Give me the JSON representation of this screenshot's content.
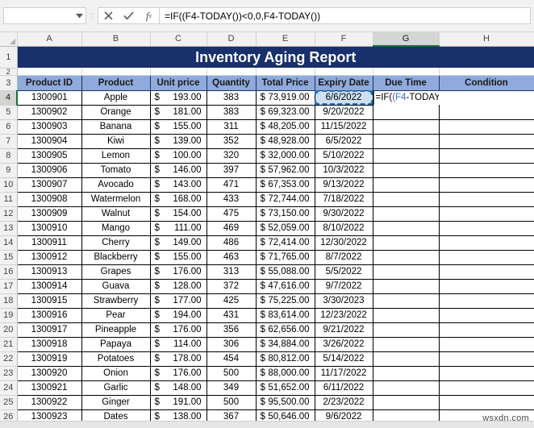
{
  "formula_bar": {
    "name_box_value": "",
    "name_box_placeholder": "",
    "cancel_icon": "cancel-x-icon",
    "confirm_icon": "confirm-check-icon",
    "insert_function_icon": "fx-icon",
    "formula_text": "=IF((F4-TODAY())<0,0,F4-TODAY())"
  },
  "sheet": {
    "column_headers": [
      "A",
      "B",
      "C",
      "D",
      "E",
      "F",
      "G",
      "H"
    ],
    "active_column": "G",
    "active_row": 4,
    "row_numbers": [
      1,
      2,
      3,
      4,
      5,
      6,
      7,
      8,
      9,
      10,
      11,
      12,
      13,
      14,
      15,
      16,
      17,
      18,
      19,
      20,
      21,
      22,
      23,
      24,
      25,
      26
    ],
    "title": "Inventory Aging Report",
    "title_bg_color": "#18306B",
    "title_text_color": "#FFFFFF",
    "header_bg_color": "#8FAADC",
    "headers": [
      "Product ID",
      "Product",
      "Unit price",
      "Quantity",
      "Total Price",
      "Expiry Date",
      "Due Time",
      "Condition"
    ],
    "source_cell": {
      "address": "F4",
      "value": "6/6/2022",
      "highlight_color": "#CFE0F3",
      "marquee_color": "#2A6FC4"
    },
    "editing_cell": {
      "address": "G4",
      "text": "=IF((F4-TODAY())<0,0,F4-TODAY())",
      "tokens": [
        {
          "t": "=IF(",
          "c": "plain"
        },
        {
          "t": "(",
          "c": "p1"
        },
        {
          "t": "F4",
          "c": "ref"
        },
        {
          "t": "-TODAY(",
          "c": "plain"
        },
        {
          "t": ")",
          "c": "p2"
        },
        {
          "t": ")",
          "c": "p1"
        },
        {
          "t": "<0,0,",
          "c": "plain"
        },
        {
          "t": "F4",
          "c": "ref"
        },
        {
          "t": "-TODAY(",
          "c": "plain"
        },
        {
          "t": ")",
          "c": "p2"
        },
        {
          "t": ")",
          "c": "p1"
        }
      ]
    },
    "rows": [
      {
        "row": 4,
        "id": "1300901",
        "product": "Apple",
        "unit_price": "193.00",
        "quantity": "383",
        "total_price": "73,919.00",
        "expiry": "6/6/2022",
        "due_time": "",
        "condition": ""
      },
      {
        "row": 5,
        "id": "1300902",
        "product": "Orange",
        "unit_price": "181.00",
        "quantity": "383",
        "total_price": "69,323.00",
        "expiry": "9/20/2022",
        "due_time": "",
        "condition": ""
      },
      {
        "row": 6,
        "id": "1300903",
        "product": "Banana",
        "unit_price": "155.00",
        "quantity": "311",
        "total_price": "48,205.00",
        "expiry": "11/15/2022",
        "due_time": "",
        "condition": ""
      },
      {
        "row": 7,
        "id": "1300904",
        "product": "Kiwi",
        "unit_price": "139.00",
        "quantity": "352",
        "total_price": "48,928.00",
        "expiry": "6/5/2022",
        "due_time": "",
        "condition": ""
      },
      {
        "row": 8,
        "id": "1300905",
        "product": "Lemon",
        "unit_price": "100.00",
        "quantity": "320",
        "total_price": "32,000.00",
        "expiry": "5/10/2022",
        "due_time": "",
        "condition": ""
      },
      {
        "row": 9,
        "id": "1300906",
        "product": "Tomato",
        "unit_price": "146.00",
        "quantity": "397",
        "total_price": "57,962.00",
        "expiry": "10/3/2022",
        "due_time": "",
        "condition": ""
      },
      {
        "row": 10,
        "id": "1300907",
        "product": "Avocado",
        "unit_price": "143.00",
        "quantity": "471",
        "total_price": "67,353.00",
        "expiry": "9/13/2022",
        "due_time": "",
        "condition": ""
      },
      {
        "row": 11,
        "id": "1300908",
        "product": "Watermelon",
        "unit_price": "168.00",
        "quantity": "433",
        "total_price": "72,744.00",
        "expiry": "7/18/2022",
        "due_time": "",
        "condition": ""
      },
      {
        "row": 12,
        "id": "1300909",
        "product": "Walnut",
        "unit_price": "154.00",
        "quantity": "475",
        "total_price": "73,150.00",
        "expiry": "9/30/2022",
        "due_time": "",
        "condition": ""
      },
      {
        "row": 13,
        "id": "1300910",
        "product": "Mango",
        "unit_price": "111.00",
        "quantity": "469",
        "total_price": "52,059.00",
        "expiry": "8/10/2022",
        "due_time": "",
        "condition": ""
      },
      {
        "row": 14,
        "id": "1300911",
        "product": "Cherry",
        "unit_price": "149.00",
        "quantity": "486",
        "total_price": "72,414.00",
        "expiry": "12/30/2022",
        "due_time": "",
        "condition": ""
      },
      {
        "row": 15,
        "id": "1300912",
        "product": "Blackberry",
        "unit_price": "155.00",
        "quantity": "463",
        "total_price": "71,765.00",
        "expiry": "8/7/2022",
        "due_time": "",
        "condition": ""
      },
      {
        "row": 16,
        "id": "1300913",
        "product": "Grapes",
        "unit_price": "176.00",
        "quantity": "313",
        "total_price": "55,088.00",
        "expiry": "5/5/2022",
        "due_time": "",
        "condition": ""
      },
      {
        "row": 17,
        "id": "1300914",
        "product": "Guava",
        "unit_price": "128.00",
        "quantity": "372",
        "total_price": "47,616.00",
        "expiry": "9/7/2022",
        "due_time": "",
        "condition": ""
      },
      {
        "row": 18,
        "id": "1300915",
        "product": "Strawberry",
        "unit_price": "177.00",
        "quantity": "425",
        "total_price": "75,225.00",
        "expiry": "3/30/2023",
        "due_time": "",
        "condition": ""
      },
      {
        "row": 19,
        "id": "1300916",
        "product": "Pear",
        "unit_price": "194.00",
        "quantity": "431",
        "total_price": "83,614.00",
        "expiry": "12/23/2022",
        "due_time": "",
        "condition": ""
      },
      {
        "row": 20,
        "id": "1300917",
        "product": "Pineapple",
        "unit_price": "176.00",
        "quantity": "356",
        "total_price": "62,656.00",
        "expiry": "9/21/2022",
        "due_time": "",
        "condition": ""
      },
      {
        "row": 21,
        "id": "1300918",
        "product": "Papaya",
        "unit_price": "114.00",
        "quantity": "306",
        "total_price": "34,884.00",
        "expiry": "3/26/2022",
        "due_time": "",
        "condition": ""
      },
      {
        "row": 22,
        "id": "1300919",
        "product": "Potatoes",
        "unit_price": "178.00",
        "quantity": "454",
        "total_price": "80,812.00",
        "expiry": "5/14/2022",
        "due_time": "",
        "condition": ""
      },
      {
        "row": 23,
        "id": "1300920",
        "product": "Onion",
        "unit_price": "176.00",
        "quantity": "500",
        "total_price": "88,000.00",
        "expiry": "11/17/2022",
        "due_time": "",
        "condition": ""
      },
      {
        "row": 24,
        "id": "1300921",
        "product": "Garlic",
        "unit_price": "148.00",
        "quantity": "349",
        "total_price": "51,652.00",
        "expiry": "6/11/2022",
        "due_time": "",
        "condition": ""
      },
      {
        "row": 25,
        "id": "1300922",
        "product": "Ginger",
        "unit_price": "191.00",
        "quantity": "500",
        "total_price": "95,500.00",
        "expiry": "2/23/2022",
        "due_time": "",
        "condition": ""
      },
      {
        "row": 26,
        "id": "1300923",
        "product": "Dates",
        "unit_price": "138.00",
        "quantity": "367",
        "total_price": "50,646.00",
        "expiry": "9/6/2022",
        "due_time": "",
        "condition": ""
      }
    ],
    "currency_symbol": "$"
  },
  "watermark": "wsxdn.com"
}
